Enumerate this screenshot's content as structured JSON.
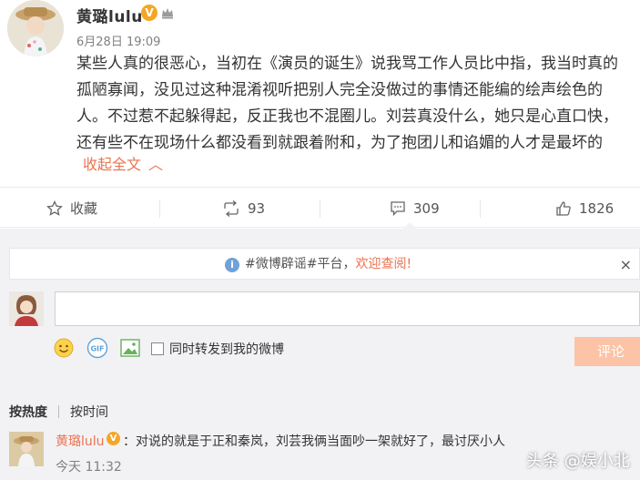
{
  "post": {
    "author": "黄璐lulu",
    "timestamp": "6月28日 19:09",
    "lines": [
      "某些人真的很恶心，当初在《演员的诞生》说我骂工作人员比中指，我当时真的",
      "孤陋寡闻，没见过这种混淆视听把别人完全没做过的事情还能编的绘声绘色的",
      "人。不过惹不起躲得起，反正我也不混圈儿。刘芸真没什么，她只是心直口快，",
      "还有些不在现场什么都没看到就跟着附和，为了抱团儿和谄媚的人才是最坏的"
    ],
    "collapse_label": "收起全文",
    "collapse_arrow": "︿"
  },
  "actions": {
    "favorite_label": "收藏",
    "repost_count": "93",
    "comment_count": "309",
    "like_count": "1826"
  },
  "notice": {
    "prefix": "#微博辟谣#平台，",
    "link": "欢迎查阅!",
    "close": "×"
  },
  "composer": {
    "repost_label": "同时转发到我的微博",
    "submit_label": "评论"
  },
  "sort": {
    "hot": "按热度",
    "time": "按时间"
  },
  "comment": {
    "author": "黄璐lulu",
    "text": "：对说的就是于正和秦岚，刘芸我俩当面吵一架就好了，最讨厌小人",
    "time": "今天 11:32"
  },
  "watermark": "头条 @娱小北",
  "colors": {
    "accent": "#eb7350",
    "verified": "#f5a623",
    "background": "#f2f2f5",
    "submit": "#fcc3a6"
  },
  "icons": {
    "verified": "verified-v-icon",
    "crown": "vip-crown-icon",
    "favorite": "star-icon",
    "repost": "repost-icon",
    "comment": "comment-icon",
    "like": "thumbs-up-icon",
    "info": "info-icon",
    "emoji": "emoji-icon",
    "gif": "gif-icon",
    "image": "image-icon"
  }
}
